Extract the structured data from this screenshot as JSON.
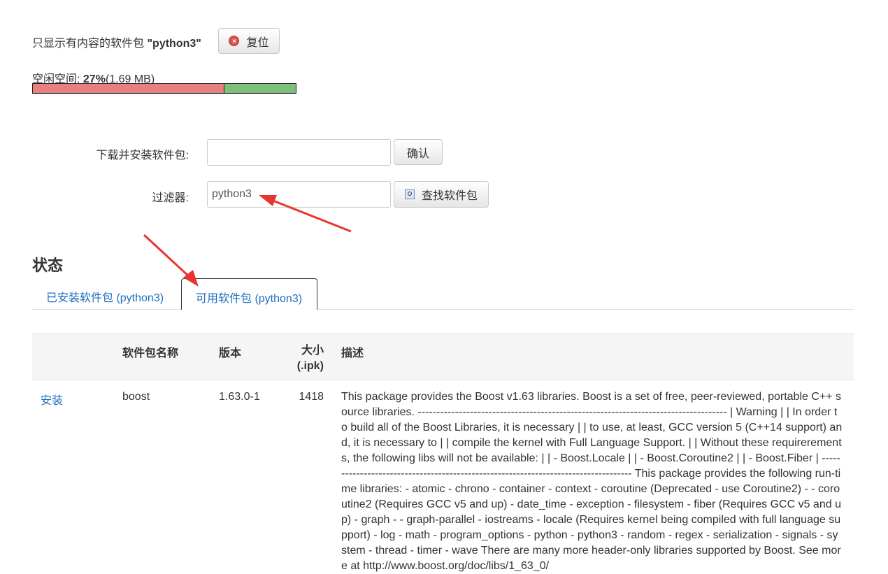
{
  "filter_notice": {
    "prefix": "只显示有内容的软件包",
    "query": "\"python3\"",
    "reset_label": "复位"
  },
  "free_space": {
    "label_prefix": "空闲空间: ",
    "percent": "27%",
    "size": "(1.69 MB)",
    "paren_open": " (",
    "size_value": "1.69 MB",
    "paren_close": ")",
    "used_fraction": 0.73,
    "used_color": "#e88080",
    "free_color": "#7cc07c"
  },
  "install_form": {
    "label": "下载并安装软件包:",
    "value": "",
    "confirm_label": "确认"
  },
  "filter_form": {
    "label": "过滤器:",
    "value": "python3",
    "search_label": "查找软件包"
  },
  "status": {
    "title": "状态",
    "tabs": [
      {
        "label": "已安装软件包 (python3)",
        "active": false
      },
      {
        "label": "可用软件包 (python3)",
        "active": true
      }
    ]
  },
  "table": {
    "headers": {
      "action": "",
      "name": "软件包名称",
      "version": "版本",
      "size_line1": "大小",
      "size_line2": "(.ipk)",
      "description": "描述"
    },
    "rows": [
      {
        "action": "安装",
        "name": "boost",
        "version": "1.63.0-1",
        "size": "1418",
        "description": "This package provides the Boost v1.63 libraries. Boost is a set of free, peer-reviewed, portable C++ source libraries. ----------------------------------------------------------------------------------- | Warning | | In order to build all of the Boost Libraries, it is necessary | | to use, at least, GCC version 5 (C++14 support) and, it is necessary to | | compile the kernel with Full Language Support. | | Without these requirerements, the following libs will not be available: | | - Boost.Locale | | - Boost.Coroutine2 | | - Boost.Fiber | ----------------------------------------------------------------------------------- This package provides the following run-time libraries: - atomic - chrono - container - context - coroutine (Deprecated - use Coroutine2) - - coroutine2 (Requires GCC v5 and up) - date_time - exception - filesystem - fiber (Requires GCC v5 and up) - graph - - graph-parallel - iostreams - locale (Requires kernel being compiled with full language support) - log - math - program_options - python - python3 - random - regex - serialization - signals - system - thread - timer - wave There are many more header-only libraries supported by Boost. See more at http://www.boost.org/doc/libs/1_63_0/"
      }
    ]
  },
  "annotation_color": "#e8362e"
}
